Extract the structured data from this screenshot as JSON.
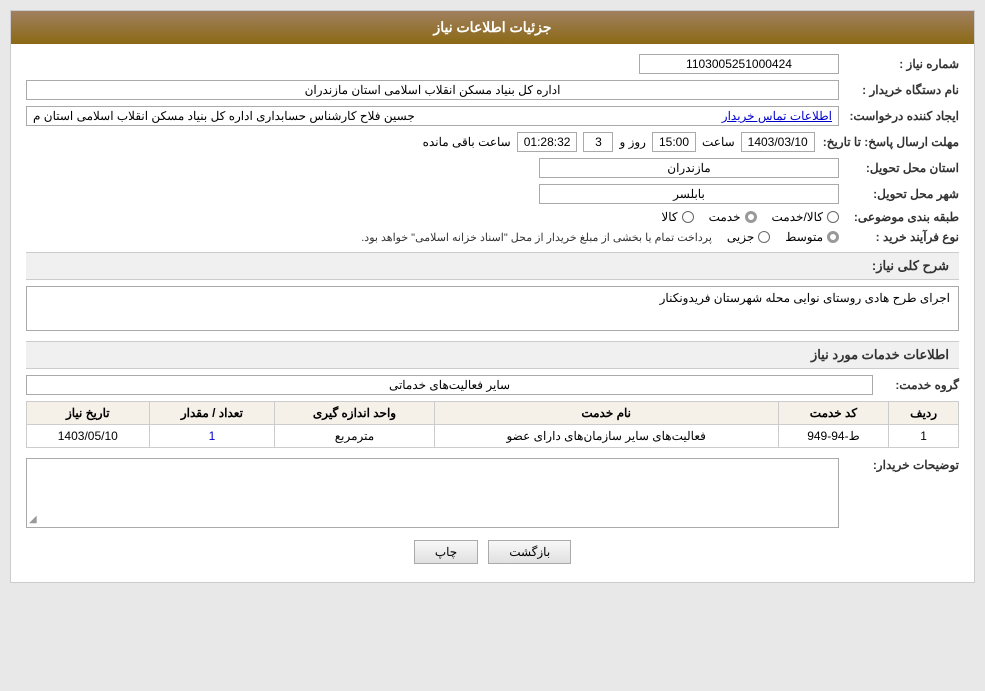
{
  "page": {
    "title": "جزئیات اطلاعات نیاز",
    "header": {
      "bg_color": "#8b6914"
    }
  },
  "fields": {
    "shomara_niaz_label": "شماره نیاز :",
    "shomara_niaz_value": "1103005251000424",
    "nam_dastgah_label": "نام دستگاه خریدار :",
    "nam_dastgah_value": "اداره کل بنیاد مسکن انقلاب اسلامی استان مازندران",
    "ijad_label": "ایجاد کننده درخواست:",
    "ijad_value": "جسین فلاح کارشناس حسابداری اداره کل بنیاد مسکن انقلاب اسلامی استان م",
    "ijad_link": "اطلاعات تماس خریدار",
    "mohlat_label": "مهلت ارسال پاسخ: تا تاریخ:",
    "tarikh_value": "1403/03/10",
    "saat_label": "ساعت",
    "saat_value": "15:00",
    "rooz_label": "روز و",
    "rooz_value": "3",
    "baghimandeh_value": "01:28:32",
    "baghimandeh_label": "ساعت باقی مانده",
    "ostan_label": "استان محل تحویل:",
    "ostan_value": "مازندران",
    "shahr_label": "شهر محل تحویل:",
    "shahr_value": "بابلسر",
    "tabaghe_label": "طبقه بندی موضوعی:",
    "tabaghe_options": [
      "کالا",
      "خدمت",
      "کالا/خدمت"
    ],
    "tabaghe_selected": "خدمت",
    "navoe_label": "نوع فرآیند خرید :",
    "navoe_options": [
      "جزیی",
      "متوسط"
    ],
    "navoe_selected": "متوسط",
    "navoe_desc": "پرداخت تمام یا بخشی از مبلغ خریدار از محل \"اسناد خزانه اسلامی\" خواهد بود.",
    "sharh_label": "شرح کلی نیاز:",
    "sharh_value": "اجرای طرح هادی روستای نوایی محله شهرستان  فریدونکنار",
    "khadamat_label": "اطلاعات خدمات مورد نیاز",
    "gorooh_label": "گروه خدمت:",
    "gorooh_value": "سایر فعالیت‌های خدماتی",
    "table": {
      "headers": [
        "ردیف",
        "کد خدمت",
        "نام خدمت",
        "واحد اندازه گیری",
        "تعداد / مقدار",
        "تاریخ نیاز"
      ],
      "rows": [
        {
          "radif": "1",
          "kod": "ط-94-949",
          "nam": "فعالیت‌های سایر سازمان‌های دارای عضو",
          "vahed": "مترمربع",
          "tedad": "1",
          "tarikh": "1403/05/10"
        }
      ]
    },
    "tozihat_label": "توضیحات خریدار:",
    "tozihat_value": "",
    "btn_print": "چاپ",
    "btn_back": "بازگشت"
  },
  "icons": {
    "resize": "◢"
  }
}
